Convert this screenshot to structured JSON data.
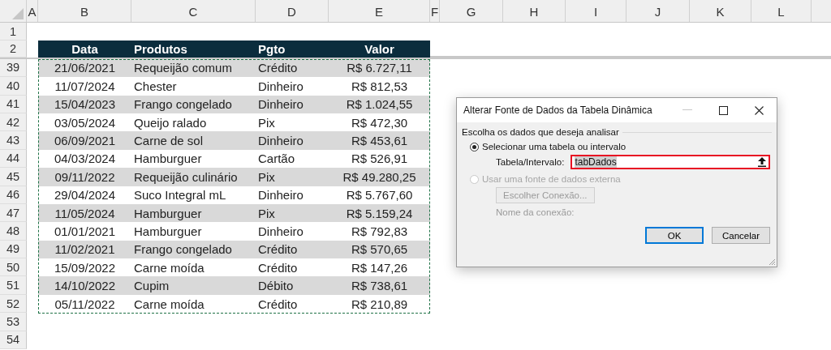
{
  "column_headers": [
    "A",
    "B",
    "C",
    "D",
    "E",
    "F",
    "G",
    "H",
    "I",
    "J",
    "K",
    "L"
  ],
  "top_rows": [
    "1"
  ],
  "table": {
    "row_number": "2",
    "columns": [
      "Data",
      "Produtos",
      "Pgto",
      "Valor"
    ],
    "rows": [
      {
        "row": "39",
        "cells": [
          "21/06/2021",
          "Requeijão comum",
          "Crédito",
          "R$ 6.727,11"
        ]
      },
      {
        "row": "40",
        "cells": [
          "11/07/2024",
          "Chester",
          "Dinheiro",
          "R$ 812,53"
        ]
      },
      {
        "row": "41",
        "cells": [
          "15/04/2023",
          "Frango congelado",
          "Dinheiro",
          "R$ 1.024,55"
        ]
      },
      {
        "row": "42",
        "cells": [
          "03/05/2024",
          "Queijo ralado",
          "Pix",
          "R$ 472,30"
        ]
      },
      {
        "row": "43",
        "cells": [
          "06/09/2021",
          "Carne de sol",
          "Dinheiro",
          "R$ 453,61"
        ]
      },
      {
        "row": "44",
        "cells": [
          "04/03/2024",
          "Hamburguer",
          "Cartão",
          "R$ 526,91"
        ]
      },
      {
        "row": "45",
        "cells": [
          "09/11/2022",
          "Requeijão culinário",
          "Pix",
          "R$ 49.280,25"
        ]
      },
      {
        "row": "46",
        "cells": [
          "29/04/2024",
          "Suco Integral mL",
          "Dinheiro",
          "R$ 5.767,60"
        ]
      },
      {
        "row": "47",
        "cells": [
          "11/05/2024",
          "Hamburguer",
          "Pix",
          "R$ 5.159,24"
        ]
      },
      {
        "row": "48",
        "cells": [
          "01/01/2021",
          "Hamburguer",
          "Dinheiro",
          "R$ 792,83"
        ]
      },
      {
        "row": "49",
        "cells": [
          "11/02/2021",
          "Frango congelado",
          "Crédito",
          "R$ 570,65"
        ]
      },
      {
        "row": "50",
        "cells": [
          "15/09/2022",
          "Carne moída",
          "Crédito",
          "R$ 147,26"
        ]
      },
      {
        "row": "51",
        "cells": [
          "14/10/2022",
          "Cupim",
          "Débito",
          "R$ 738,61"
        ]
      },
      {
        "row": "52",
        "cells": [
          "05/11/2022",
          "Carne moída",
          "Crédito",
          "R$ 210,89"
        ]
      }
    ]
  },
  "bottom_rows": [
    "53",
    "54"
  ],
  "dialog": {
    "title": "Alterar Fonte de Dados da Tabela Dinâmica",
    "group_label": "Escolha os dados que deseja analisar",
    "options": [
      {
        "label": "Selecionar uma tabela ou intervalo",
        "selected": true,
        "disabled": false
      },
      {
        "label": "Usar uma fonte de dados externa",
        "selected": false,
        "disabled": true
      }
    ],
    "range_label": "Tabela/Intervalo:",
    "range_value": "tabDados",
    "connection_button": {
      "label": "Escolher Conexão...",
      "disabled": true
    },
    "connection_label": "Nome da conexão:",
    "buttons": [
      {
        "label": "OK",
        "default": true
      },
      {
        "label": "Cancelar",
        "default": false
      }
    ]
  }
}
